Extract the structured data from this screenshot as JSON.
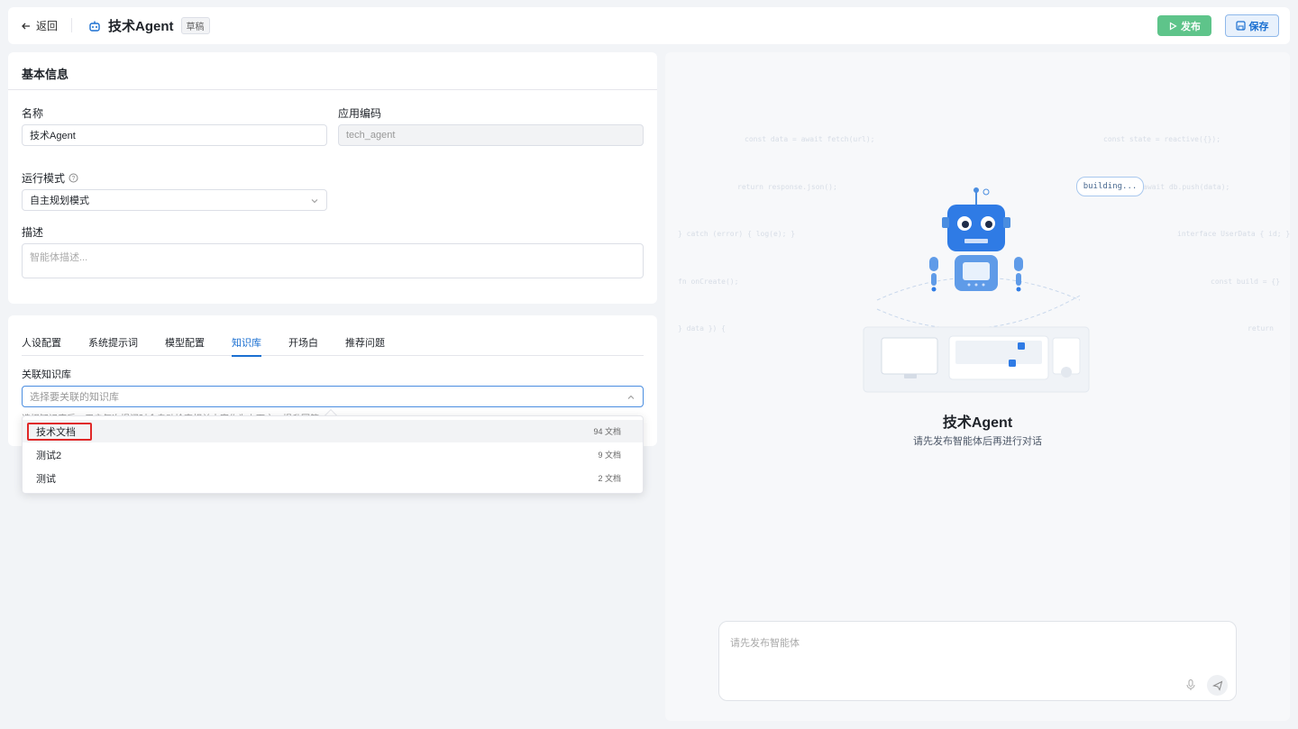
{
  "header": {
    "back_label": "返回",
    "app_title": "技术Agent",
    "status_badge": "草稿",
    "publish_label": "发布",
    "save_label": "保存",
    "accent_color": "#1a6fd1",
    "publish_color": "#5ec48a"
  },
  "basic_info": {
    "title": "基本信息",
    "name_label": "名称",
    "name_value": "技术Agent",
    "code_label": "应用编码",
    "code_value": "tech_agent",
    "mode_label": "运行模式",
    "mode_value": "自主规划模式",
    "desc_label": "描述",
    "desc_placeholder": "智能体描述..."
  },
  "tabs": [
    {
      "label": "人设配置",
      "active": false
    },
    {
      "label": "系统提示词",
      "active": false
    },
    {
      "label": "模型配置",
      "active": false
    },
    {
      "label": "知识库",
      "active": true
    },
    {
      "label": "开场白",
      "active": false
    },
    {
      "label": "推荐问题",
      "active": false
    }
  ],
  "knowledge": {
    "label": "关联知识库",
    "select_placeholder": "选择要关联的知识库",
    "hint": "选择知识库后，用户每次提问时会自动检索相关内容作为上下文，提升回答准确性"
  },
  "dropdown": {
    "options": [
      {
        "name": "技术文档",
        "count": "94 文档",
        "highlighted": true
      },
      {
        "name": "测试2",
        "count": "9 文档",
        "highlighted": false
      },
      {
        "name": "测试",
        "count": "2 文档",
        "highlighted": false
      }
    ]
  },
  "preview": {
    "bubble_text": "building...",
    "agent_name": "技术Agent",
    "subtitle": "请先发布智能体后再进行对话",
    "chat_placeholder": "请先发布智能体"
  }
}
